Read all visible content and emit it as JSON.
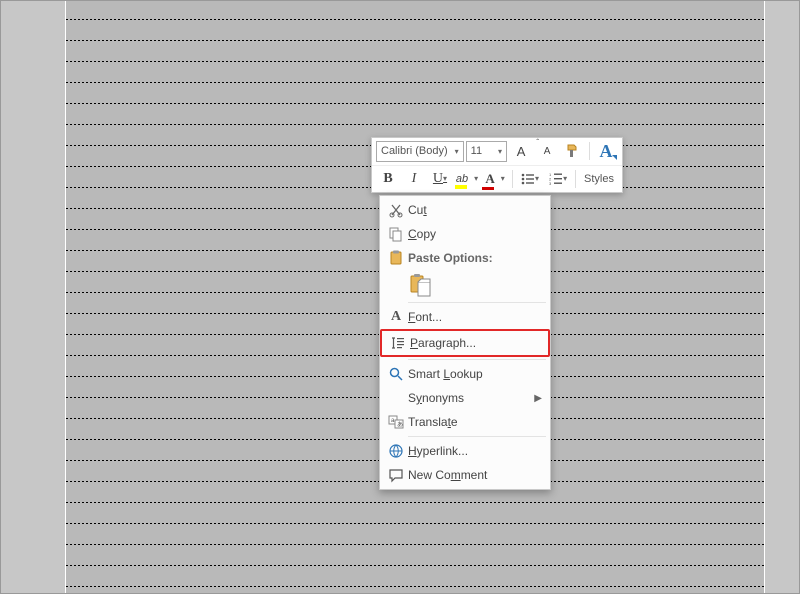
{
  "mini_toolbar": {
    "font_name": "Calibri (Body)",
    "font_size": "11",
    "grow_font_label": "A",
    "shrink_font_label": "A",
    "format_painter_label": "",
    "styles_label": "Styles",
    "bold_label": "B",
    "italic_label": "I",
    "underline_label": "U",
    "highlight_label": "ab",
    "font_color_label": "A"
  },
  "context_menu": {
    "cut": "Cut",
    "copy": "Copy",
    "paste_options": "Paste Options:",
    "font": "Font...",
    "paragraph": "Paragraph...",
    "smart_lookup": "Smart Lookup",
    "synonyms": "Synonyms",
    "translate": "Translate",
    "hyperlink": "Hyperlink...",
    "new_comment": "New Comment"
  }
}
